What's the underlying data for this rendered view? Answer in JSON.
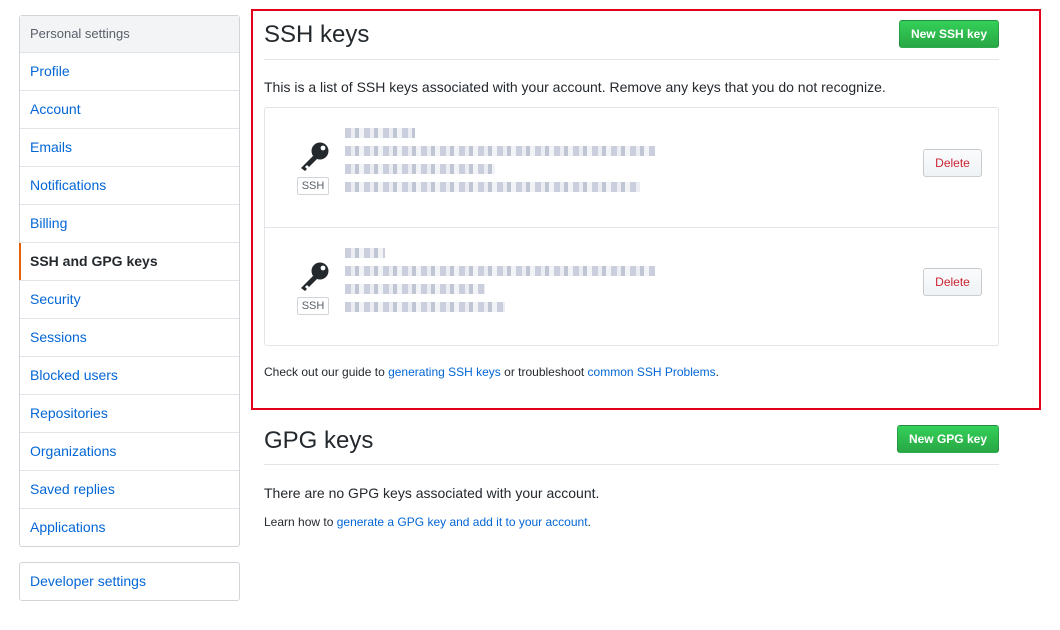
{
  "sidebar": {
    "heading": "Personal settings",
    "items": [
      {
        "label": "Profile"
      },
      {
        "label": "Account"
      },
      {
        "label": "Emails"
      },
      {
        "label": "Notifications"
      },
      {
        "label": "Billing"
      },
      {
        "label": "SSH and GPG keys"
      },
      {
        "label": "Security"
      },
      {
        "label": "Sessions"
      },
      {
        "label": "Blocked users"
      },
      {
        "label": "Repositories"
      },
      {
        "label": "Organizations"
      },
      {
        "label": "Saved replies"
      },
      {
        "label": "Applications"
      }
    ],
    "selected": "SSH and GPG keys",
    "developer": "Developer settings"
  },
  "ssh": {
    "title": "SSH keys",
    "new_button": "New SSH key",
    "description": "This is a list of SSH keys associated with your account. Remove any keys that you do not recognize.",
    "keys": [
      {
        "badge": "SSH",
        "delete_label": "Delete"
      },
      {
        "badge": "SSH",
        "delete_label": "Delete"
      }
    ],
    "footer": {
      "prefix": "Check out our guide to ",
      "link1": "generating SSH keys",
      "middle": " or troubleshoot ",
      "link2": "common SSH Problems",
      "suffix": "."
    }
  },
  "gpg": {
    "title": "GPG keys",
    "new_button": "New GPG key",
    "description": "There are no GPG keys associated with your account.",
    "footer": {
      "prefix": "Learn how to ",
      "link": "generate a GPG key and add it to your account",
      "suffix": "."
    }
  },
  "colors": {
    "link": "#0366d6",
    "selected_indicator": "#e36209",
    "highlight_border": "#e3001b",
    "primary_button": "#28a745",
    "danger_text": "#cb2431"
  }
}
